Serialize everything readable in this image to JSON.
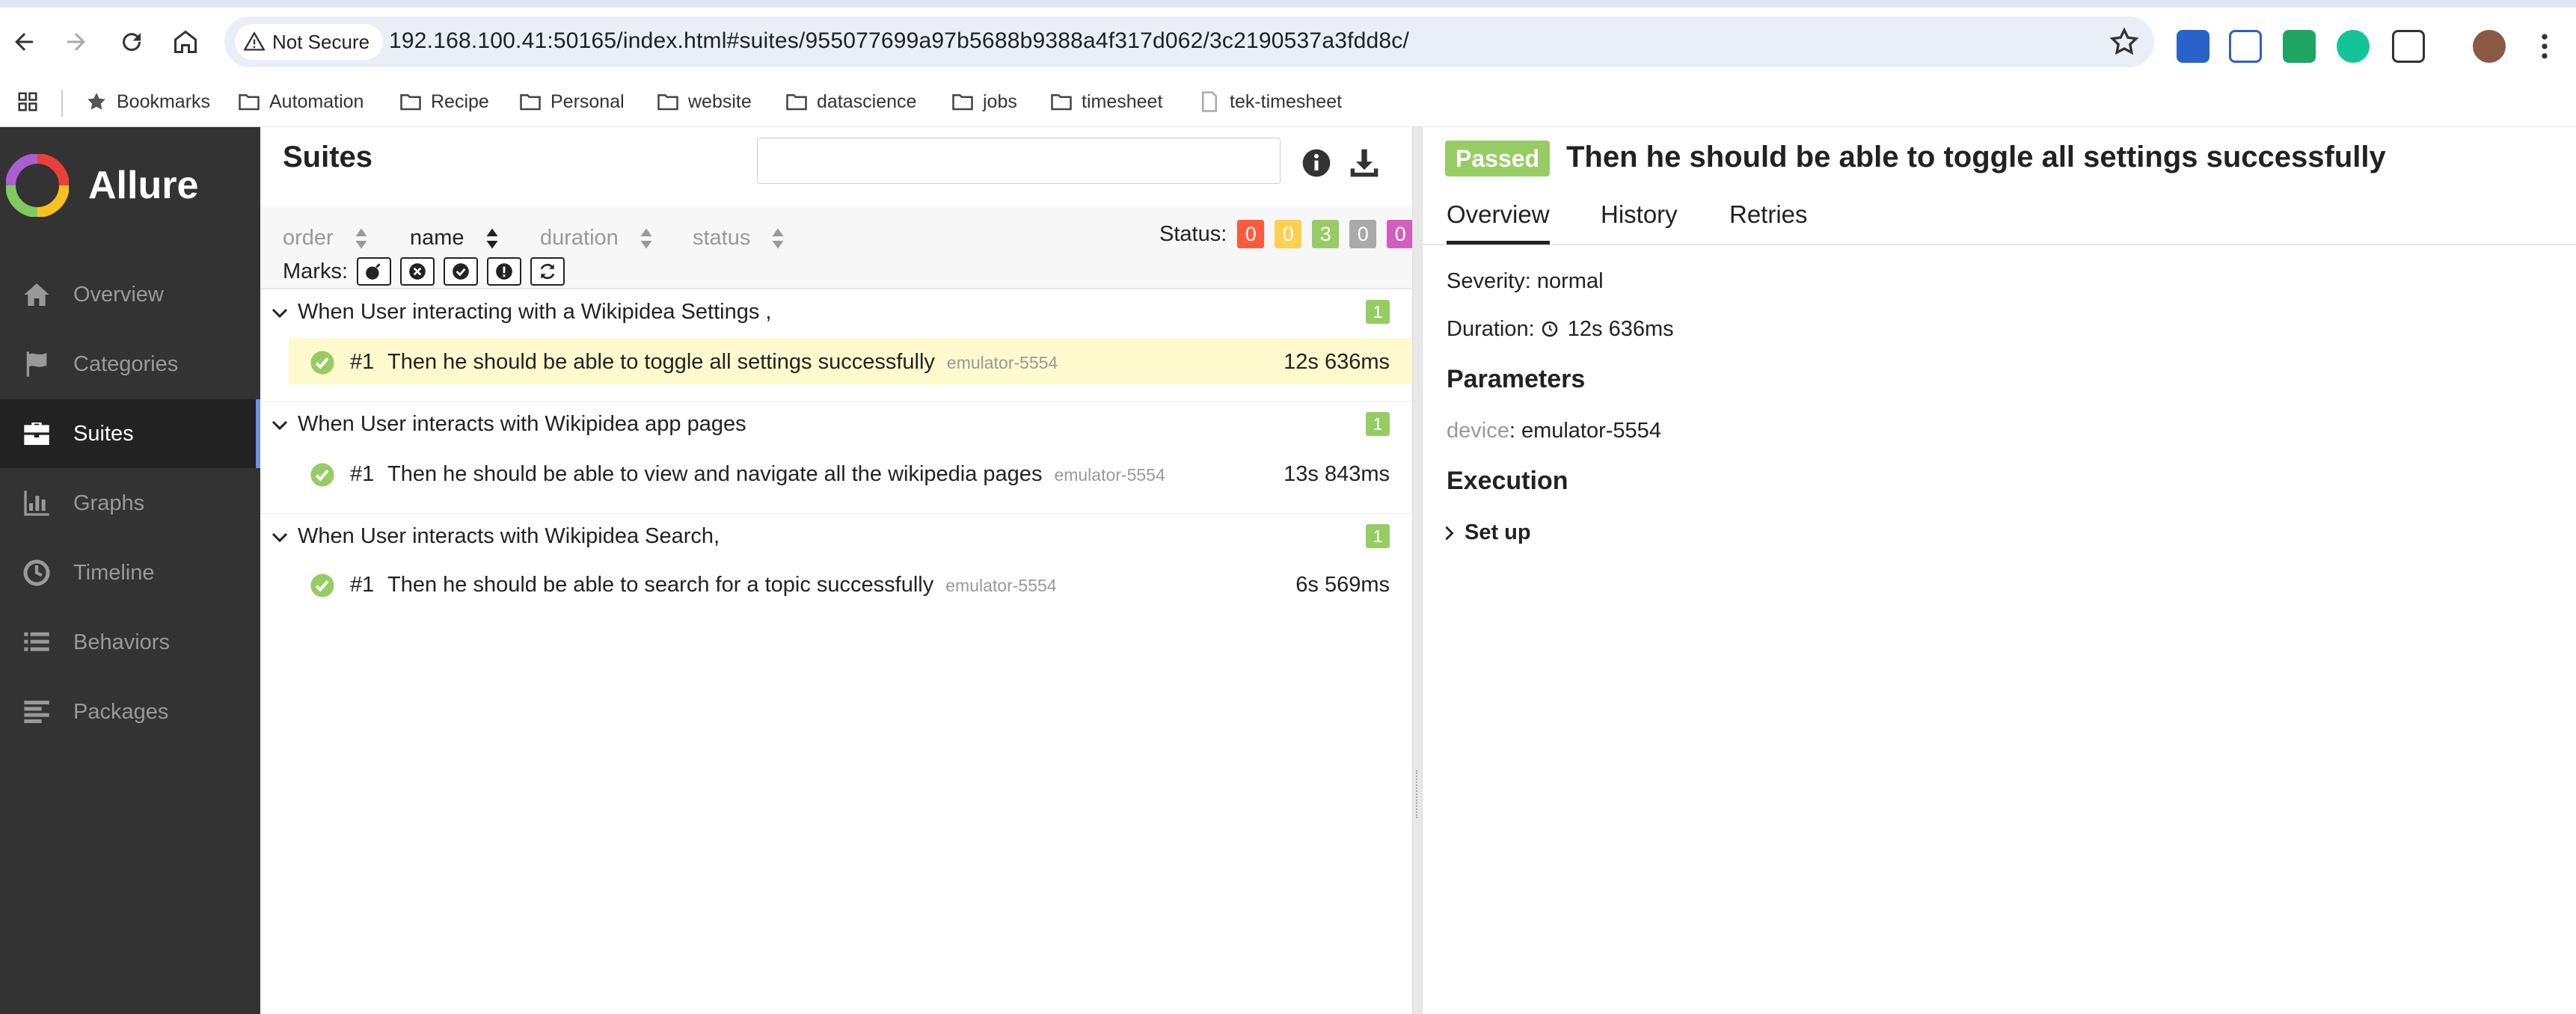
{
  "browser": {
    "security_label": "Not Secure",
    "url": "192.168.100.41:50165/index.html#suites/955077699a97b5688b9388a4f317d062/3c2190537a3fdd8c/",
    "bookmarks": [
      {
        "label": "Bookmarks",
        "icon": "star-icon"
      },
      {
        "label": "Automation",
        "icon": "folder-icon"
      },
      {
        "label": "Recipe",
        "icon": "folder-icon"
      },
      {
        "label": "Personal",
        "icon": "folder-icon"
      },
      {
        "label": "website",
        "icon": "folder-icon"
      },
      {
        "label": "datascience",
        "icon": "folder-icon"
      },
      {
        "label": "jobs",
        "icon": "folder-icon"
      },
      {
        "label": "timesheet",
        "icon": "folder-icon"
      },
      {
        "label": "tek-timesheet",
        "icon": "page-icon"
      }
    ]
  },
  "sidebar": {
    "brand": "Allure",
    "items": [
      {
        "label": "Overview",
        "icon": "home-icon",
        "active": false
      },
      {
        "label": "Categories",
        "icon": "flag-icon",
        "active": false
      },
      {
        "label": "Suites",
        "icon": "briefcase-icon",
        "active": true
      },
      {
        "label": "Graphs",
        "icon": "bar-chart-icon",
        "active": false
      },
      {
        "label": "Timeline",
        "icon": "clock-icon",
        "active": false
      },
      {
        "label": "Behaviors",
        "icon": "list-icon",
        "active": false
      },
      {
        "label": "Packages",
        "icon": "align-left-icon",
        "active": false
      }
    ]
  },
  "suites": {
    "title": "Suites",
    "search_placeholder": "",
    "sort_columns": [
      "order",
      "name",
      "duration",
      "status"
    ],
    "status_label": "Status:",
    "status_counts": [
      {
        "value": "0",
        "color": "#fd5a3e"
      },
      {
        "value": "0",
        "color": "#ffd050"
      },
      {
        "value": "3",
        "color": "#97cc64"
      },
      {
        "value": "0",
        "color": "#aaaaaa"
      },
      {
        "value": "0",
        "color": "#d35ebe"
      }
    ],
    "marks_label": "Marks:",
    "marks": [
      "flaky-icon",
      "new-failed-icon",
      "new-passed-icon",
      "new-broken-icon",
      "retries-icon"
    ],
    "groups": [
      {
        "title": "When User interacting with a Wikipidea Settings ,",
        "count": "1",
        "tests": [
          {
            "num": "#1",
            "name": "Then he should be able to toggle all settings successfully",
            "param": "emulator-5554",
            "duration": "12s 636ms",
            "selected": true
          }
        ]
      },
      {
        "title": "When User interacts with Wikipidea app pages",
        "count": "1",
        "tests": [
          {
            "num": "#1",
            "name": "Then he should be able to view and navigate all the wikipedia pages",
            "param": "emulator-5554",
            "duration": "13s 843ms",
            "selected": false
          }
        ]
      },
      {
        "title": "When User interacts with Wikipidea Search,",
        "count": "1",
        "tests": [
          {
            "num": "#1",
            "name": "Then he should be able to search for a topic successfully",
            "param": "emulator-5554",
            "duration": "6s 569ms",
            "selected": false
          }
        ]
      }
    ]
  },
  "detail": {
    "status": "Passed",
    "title": "Then he should be able to toggle all settings successfully",
    "tabs": [
      "Overview",
      "History",
      "Retries"
    ],
    "severity": "Severity: normal",
    "duration_label": "Duration:",
    "duration": "12s 636ms",
    "parameters_heading": "Parameters",
    "param_key": "device",
    "param_value": ": emulator-5554",
    "execution_heading": "Execution",
    "setup_label": "Set up"
  }
}
